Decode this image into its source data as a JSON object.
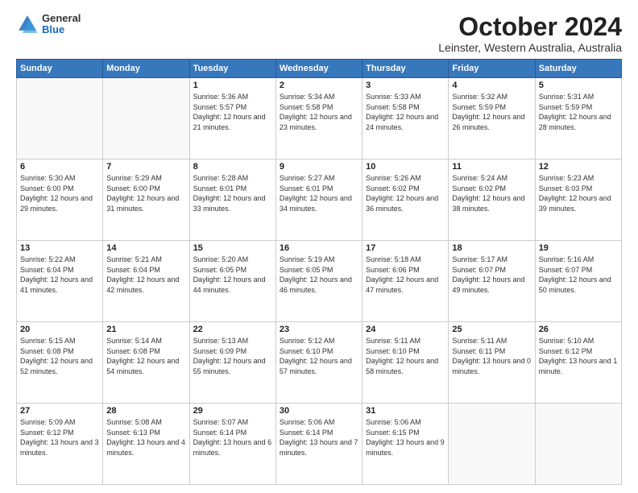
{
  "logo": {
    "general": "General",
    "blue": "Blue"
  },
  "title": "October 2024",
  "subtitle": "Leinster, Western Australia, Australia",
  "days_header": [
    "Sunday",
    "Monday",
    "Tuesday",
    "Wednesday",
    "Thursday",
    "Friday",
    "Saturday"
  ],
  "weeks": [
    [
      {
        "day": "",
        "info": ""
      },
      {
        "day": "",
        "info": ""
      },
      {
        "day": "1",
        "info": "Sunrise: 5:36 AM\nSunset: 5:57 PM\nDaylight: 12 hours and 21 minutes."
      },
      {
        "day": "2",
        "info": "Sunrise: 5:34 AM\nSunset: 5:58 PM\nDaylight: 12 hours and 23 minutes."
      },
      {
        "day": "3",
        "info": "Sunrise: 5:33 AM\nSunset: 5:58 PM\nDaylight: 12 hours and 24 minutes."
      },
      {
        "day": "4",
        "info": "Sunrise: 5:32 AM\nSunset: 5:59 PM\nDaylight: 12 hours and 26 minutes."
      },
      {
        "day": "5",
        "info": "Sunrise: 5:31 AM\nSunset: 5:59 PM\nDaylight: 12 hours and 28 minutes."
      }
    ],
    [
      {
        "day": "6",
        "info": "Sunrise: 5:30 AM\nSunset: 6:00 PM\nDaylight: 12 hours and 29 minutes."
      },
      {
        "day": "7",
        "info": "Sunrise: 5:29 AM\nSunset: 6:00 PM\nDaylight: 12 hours and 31 minutes."
      },
      {
        "day": "8",
        "info": "Sunrise: 5:28 AM\nSunset: 6:01 PM\nDaylight: 12 hours and 33 minutes."
      },
      {
        "day": "9",
        "info": "Sunrise: 5:27 AM\nSunset: 6:01 PM\nDaylight: 12 hours and 34 minutes."
      },
      {
        "day": "10",
        "info": "Sunrise: 5:26 AM\nSunset: 6:02 PM\nDaylight: 12 hours and 36 minutes."
      },
      {
        "day": "11",
        "info": "Sunrise: 5:24 AM\nSunset: 6:02 PM\nDaylight: 12 hours and 38 minutes."
      },
      {
        "day": "12",
        "info": "Sunrise: 5:23 AM\nSunset: 6:03 PM\nDaylight: 12 hours and 39 minutes."
      }
    ],
    [
      {
        "day": "13",
        "info": "Sunrise: 5:22 AM\nSunset: 6:04 PM\nDaylight: 12 hours and 41 minutes."
      },
      {
        "day": "14",
        "info": "Sunrise: 5:21 AM\nSunset: 6:04 PM\nDaylight: 12 hours and 42 minutes."
      },
      {
        "day": "15",
        "info": "Sunrise: 5:20 AM\nSunset: 6:05 PM\nDaylight: 12 hours and 44 minutes."
      },
      {
        "day": "16",
        "info": "Sunrise: 5:19 AM\nSunset: 6:05 PM\nDaylight: 12 hours and 46 minutes."
      },
      {
        "day": "17",
        "info": "Sunrise: 5:18 AM\nSunset: 6:06 PM\nDaylight: 12 hours and 47 minutes."
      },
      {
        "day": "18",
        "info": "Sunrise: 5:17 AM\nSunset: 6:07 PM\nDaylight: 12 hours and 49 minutes."
      },
      {
        "day": "19",
        "info": "Sunrise: 5:16 AM\nSunset: 6:07 PM\nDaylight: 12 hours and 50 minutes."
      }
    ],
    [
      {
        "day": "20",
        "info": "Sunrise: 5:15 AM\nSunset: 6:08 PM\nDaylight: 12 hours and 52 minutes."
      },
      {
        "day": "21",
        "info": "Sunrise: 5:14 AM\nSunset: 6:08 PM\nDaylight: 12 hours and 54 minutes."
      },
      {
        "day": "22",
        "info": "Sunrise: 5:13 AM\nSunset: 6:09 PM\nDaylight: 12 hours and 55 minutes."
      },
      {
        "day": "23",
        "info": "Sunrise: 5:12 AM\nSunset: 6:10 PM\nDaylight: 12 hours and 57 minutes."
      },
      {
        "day": "24",
        "info": "Sunrise: 5:11 AM\nSunset: 6:10 PM\nDaylight: 12 hours and 58 minutes."
      },
      {
        "day": "25",
        "info": "Sunrise: 5:11 AM\nSunset: 6:11 PM\nDaylight: 13 hours and 0 minutes."
      },
      {
        "day": "26",
        "info": "Sunrise: 5:10 AM\nSunset: 6:12 PM\nDaylight: 13 hours and 1 minute."
      }
    ],
    [
      {
        "day": "27",
        "info": "Sunrise: 5:09 AM\nSunset: 6:12 PM\nDaylight: 13 hours and 3 minutes."
      },
      {
        "day": "28",
        "info": "Sunrise: 5:08 AM\nSunset: 6:13 PM\nDaylight: 13 hours and 4 minutes."
      },
      {
        "day": "29",
        "info": "Sunrise: 5:07 AM\nSunset: 6:14 PM\nDaylight: 13 hours and 6 minutes."
      },
      {
        "day": "30",
        "info": "Sunrise: 5:06 AM\nSunset: 6:14 PM\nDaylight: 13 hours and 7 minutes."
      },
      {
        "day": "31",
        "info": "Sunrise: 5:06 AM\nSunset: 6:15 PM\nDaylight: 13 hours and 9 minutes."
      },
      {
        "day": "",
        "info": ""
      },
      {
        "day": "",
        "info": ""
      }
    ]
  ]
}
